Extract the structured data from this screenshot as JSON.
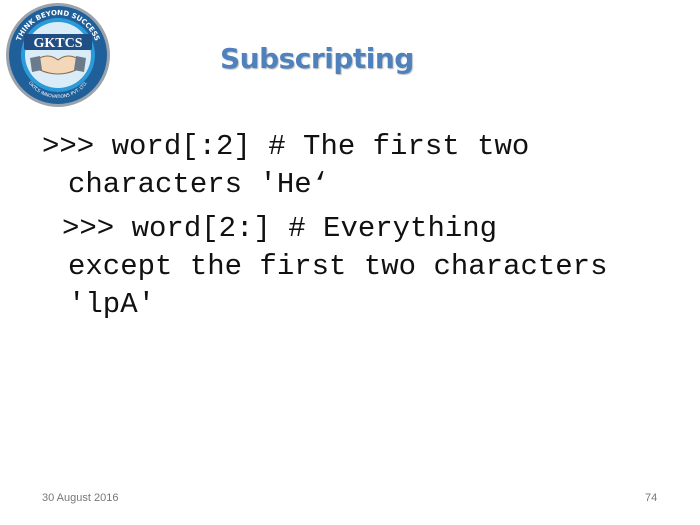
{
  "logo": {
    "brand": "GKTCS",
    "tagline": "THINK BEYOND SUCCESS",
    "company": "GKTCS INNOVATIONS PVT. LTD."
  },
  "slide": {
    "title": "Subscripting",
    "lines": [
      ">>> word[:2] # The first two",
      "characters 'He‘",
      ">>> word[2:] # Everything",
      "except the first two characters",
      "'lpA'"
    ]
  },
  "footer": {
    "date": "30 August 2016",
    "page": "74"
  },
  "colors": {
    "title": "#4f81bd",
    "logo_blue": "#1f6fb2",
    "logo_ring": "#2a9ad8",
    "text": "#111111"
  }
}
